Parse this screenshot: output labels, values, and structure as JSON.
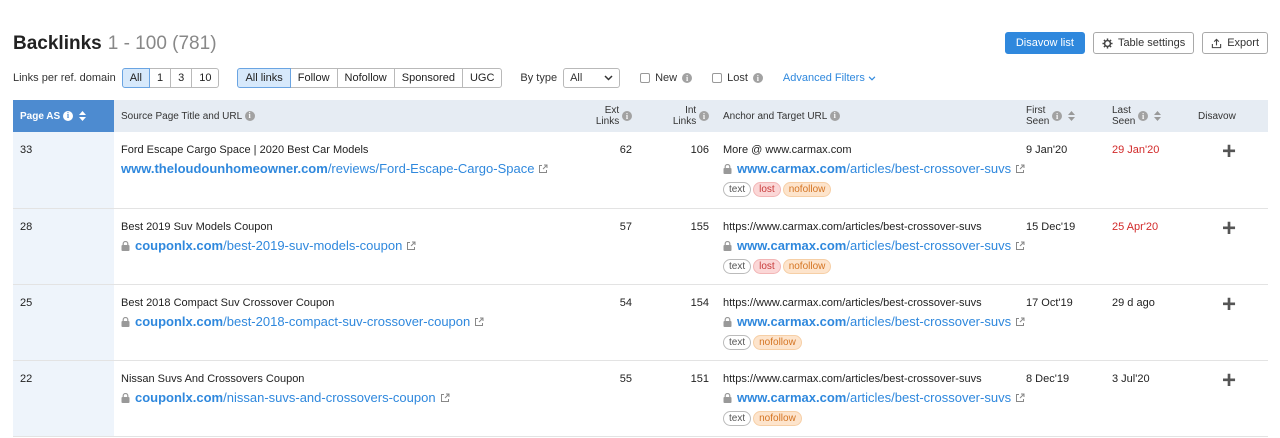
{
  "header": {
    "title": "Backlinks",
    "range": "1 - 100 (781)"
  },
  "buttons": {
    "disavow_list": "Disavow list",
    "table_settings": "Table settings",
    "export": "Export"
  },
  "filters": {
    "per_domain_label": "Links per ref. domain",
    "per_domain_options": [
      "All",
      "1",
      "3",
      "10"
    ],
    "link_types": [
      "All links",
      "Follow",
      "Nofollow",
      "Sponsored",
      "UGC"
    ],
    "by_type_label": "By type",
    "by_type_value": "All",
    "new_label": "New",
    "lost_label": "Lost",
    "advanced": "Advanced Filters"
  },
  "columns": {
    "page_as": "Page AS",
    "source": "Source Page Title and URL",
    "ext_links_1": "Ext",
    "ext_links_2": "Links",
    "int_links_1": "Int",
    "int_links_2": "Links",
    "anchor": "Anchor and Target URL",
    "first_seen_1": "First",
    "first_seen_2": "Seen",
    "last_seen_1": "Last",
    "last_seen_2": "Seen",
    "disavow": "Disavow"
  },
  "rows": [
    {
      "page_as": "33",
      "title": "Ford Escape Cargo Space | 2020 Best Car Models",
      "domain": "www.theloudounhomeowner.com",
      "path": "/reviews/Ford-Escape-Cargo-Space",
      "ext": "62",
      "int": "106",
      "anchor": "More @ www.carmax.com",
      "target_domain": "www.carmax.com",
      "target_path": "/articles/best-crossover-suvs",
      "tag1": "text",
      "tag2": "lost",
      "tag3": "nofollow",
      "first_seen": "9 Jan'20",
      "last_seen": "29 Jan'20"
    },
    {
      "page_as": "28",
      "title": "Best 2019 Suv Models Coupon",
      "domain": "couponlx.com",
      "path": "/best-2019-suv-models-coupon",
      "ext": "57",
      "int": "155",
      "anchor": "https://www.carmax.com/articles/best-crossover-suvs",
      "target_domain": "www.carmax.com",
      "target_path": "/articles/best-crossover-suvs",
      "tag1": "text",
      "tag2": "lost",
      "tag3": "nofollow",
      "first_seen": "15 Dec'19",
      "last_seen": "25 Apr'20"
    },
    {
      "page_as": "25",
      "title": "Best 2018 Compact Suv Crossover Coupon",
      "domain": "couponlx.com",
      "path": "/best-2018-compact-suv-crossover-coupon",
      "ext": "54",
      "int": "154",
      "anchor": "https://www.carmax.com/articles/best-crossover-suvs",
      "target_domain": "www.carmax.com",
      "target_path": "/articles/best-crossover-suvs",
      "tag1": "text",
      "tag3": "nofollow",
      "first_seen": "17 Oct'19",
      "last_seen": "29 d ago"
    },
    {
      "page_as": "22",
      "title": "Nissan Suvs And Crossovers Coupon",
      "domain": "couponlx.com",
      "path": "/nissan-suvs-and-crossovers-coupon",
      "ext": "55",
      "int": "151",
      "anchor": "https://www.carmax.com/articles/best-crossover-suvs",
      "target_domain": "www.carmax.com",
      "target_path": "/articles/best-crossover-suvs",
      "tag1": "text",
      "tag3": "nofollow",
      "first_seen": "8 Dec'19",
      "last_seen": "3 Jul'20"
    }
  ],
  "icons": {
    "disavow_add": "+",
    "dropdown": "▾",
    "info": "i"
  },
  "colors": {
    "accent": "#2f88dd",
    "lost_date": "#d22a2a",
    "header_active": "#4d8bd0"
  }
}
